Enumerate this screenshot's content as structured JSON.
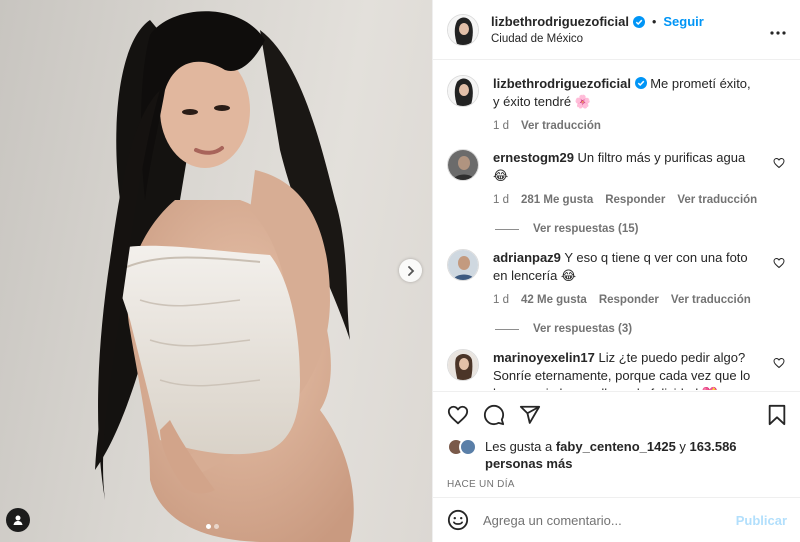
{
  "post": {
    "username": "lizbethrodriguezoficial",
    "follow_label": "Seguir",
    "separator": "•",
    "location": "Ciudad de México",
    "more_icon": "more-horizontal-icon",
    "verified_icon": "verified-badge-icon"
  },
  "media": {
    "next_icon": "chevron-right-icon",
    "carousel_pages": 2,
    "current_page": 1,
    "user_tag_icon": "user-tag-icon"
  },
  "caption": {
    "username": "lizbethrodriguezoficial",
    "text": "Me prometí éxito, y éxito tendré 🌸",
    "time": "1 d",
    "translate_label": "Ver traducción"
  },
  "comments": [
    {
      "username": "ernestogm29",
      "text": "Un filtro más y purificas agua 😂",
      "time": "1 d",
      "likes": "281 Me gusta",
      "reply_label": "Responder",
      "translate_label": "Ver traducción",
      "replies_label": "Ver respuestas (15)"
    },
    {
      "username": "adrianpaz9",
      "text": "Y eso q tiene q ver con una foto en lencería 😂",
      "time": "1 d",
      "likes": "42 Me gusta",
      "reply_label": "Responder",
      "translate_label": "Ver traducción",
      "replies_label": "Ver respuestas (3)"
    },
    {
      "username": "marinoyexelin17",
      "text": "Liz ¿te puedo pedir algo? Sonríe eternamente, porque cada vez que lo haces, mi alma se llena de felicidad 💖"
    }
  ],
  "actions": {
    "like_icon": "heart-icon",
    "comment_icon": "comment-icon",
    "share_icon": "send-icon",
    "save_icon": "bookmark-icon"
  },
  "likes": {
    "prefix": "Les gusta a",
    "user": "faby_centeno_1425",
    "connector": "y",
    "count_text": "163.586 personas más"
  },
  "time_ago": "HACE UN DÍA",
  "add_comment": {
    "emoji_icon": "emoji-icon",
    "placeholder": "Agrega un comentario...",
    "publish_label": "Publicar"
  },
  "colors": {
    "accent": "#0095f6",
    "publish_disabled": "#b2dffc",
    "secondary_text": "#737373"
  }
}
